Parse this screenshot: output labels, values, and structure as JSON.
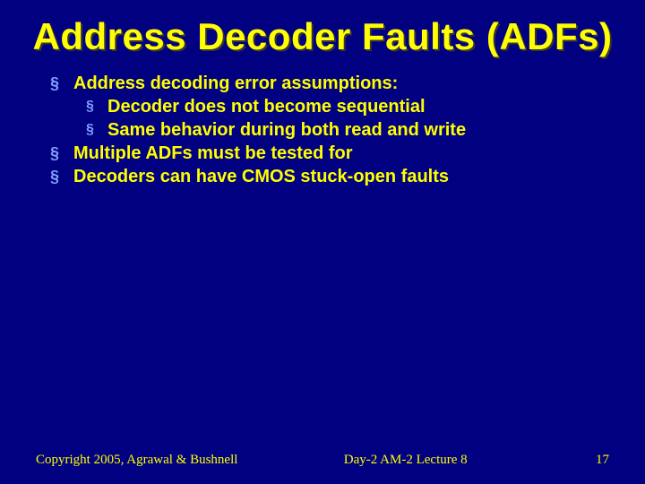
{
  "slide": {
    "title": "Address Decoder Faults (ADFs)",
    "bullets": [
      {
        "text": "Address decoding error  assumptions:",
        "children": [
          {
            "text": "Decoder does not become sequential"
          },
          {
            "text": "Same behavior during both read and write"
          }
        ]
      },
      {
        "text": "Multiple ADFs must be tested for",
        "children": []
      },
      {
        "text": "Decoders can have CMOS stuck-open faults",
        "children": []
      }
    ],
    "footer": {
      "left": "Copyright 2005, Agrawal & Bushnell",
      "center": "Day-2 AM-2 Lecture 8",
      "right": "17"
    }
  }
}
